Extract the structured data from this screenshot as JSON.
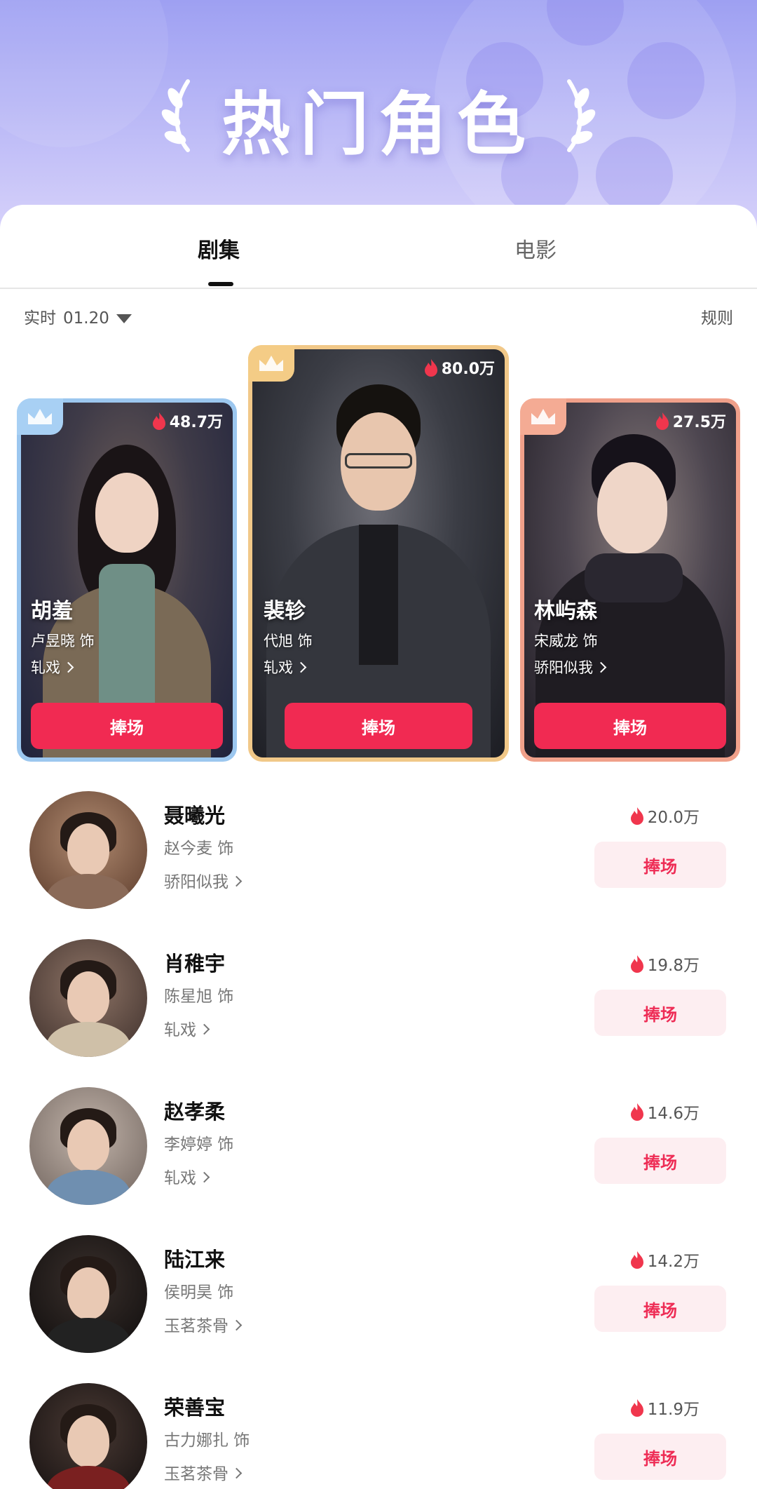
{
  "header": {
    "title": "热门角色"
  },
  "tabs": [
    {
      "label": "剧集",
      "active": true
    },
    {
      "label": "电影",
      "active": false
    }
  ],
  "filter": {
    "mode": "实时",
    "date": "01.20",
    "rules_label": "规则"
  },
  "top3": [
    {
      "rank": 2,
      "heat": "48.7万",
      "name": "胡羞",
      "actor": "卢昱晓  饰",
      "show": "轧戏",
      "cheer_label": "捧场",
      "frame_color": "#9cc7ef"
    },
    {
      "rank": 1,
      "heat": "80.0万",
      "name": "裴轸",
      "actor": "代旭  饰",
      "show": "轧戏",
      "cheer_label": "捧场",
      "frame_color": "#f1c888"
    },
    {
      "rank": 3,
      "heat": "27.5万",
      "name": "林屿森",
      "actor": "宋威龙  饰",
      "show": "骄阳似我",
      "cheer_label": "捧场",
      "frame_color": "#f0a08a"
    }
  ],
  "list": [
    {
      "name": "聂曦光",
      "actor": "赵今麦  饰",
      "show": "骄阳似我",
      "heat": "20.0万",
      "cheer_label": "捧场"
    },
    {
      "name": "肖稚宇",
      "actor": "陈星旭  饰",
      "show": "轧戏",
      "heat": "19.8万",
      "cheer_label": "捧场"
    },
    {
      "name": "赵孝柔",
      "actor": "李婷婷  饰",
      "show": "轧戏",
      "heat": "14.6万",
      "cheer_label": "捧场"
    },
    {
      "name": "陆江来",
      "actor": "侯明昊  饰",
      "show": "玉茗茶骨",
      "heat": "14.2万",
      "cheer_label": "捧场"
    },
    {
      "name": "荣善宝",
      "actor": "古力娜扎  饰",
      "show": "玉茗茶骨",
      "heat": "11.9万",
      "cheer_label": "捧场"
    }
  ],
  "colors": {
    "accent": "#f12a52",
    "cheer_soft_bg": "#fdeef1",
    "flame": "#f0364d"
  },
  "icons": {
    "crown": "crown-icon",
    "flame": "flame-icon",
    "chevron": "chevron-right-icon",
    "caret": "caret-down-icon"
  }
}
